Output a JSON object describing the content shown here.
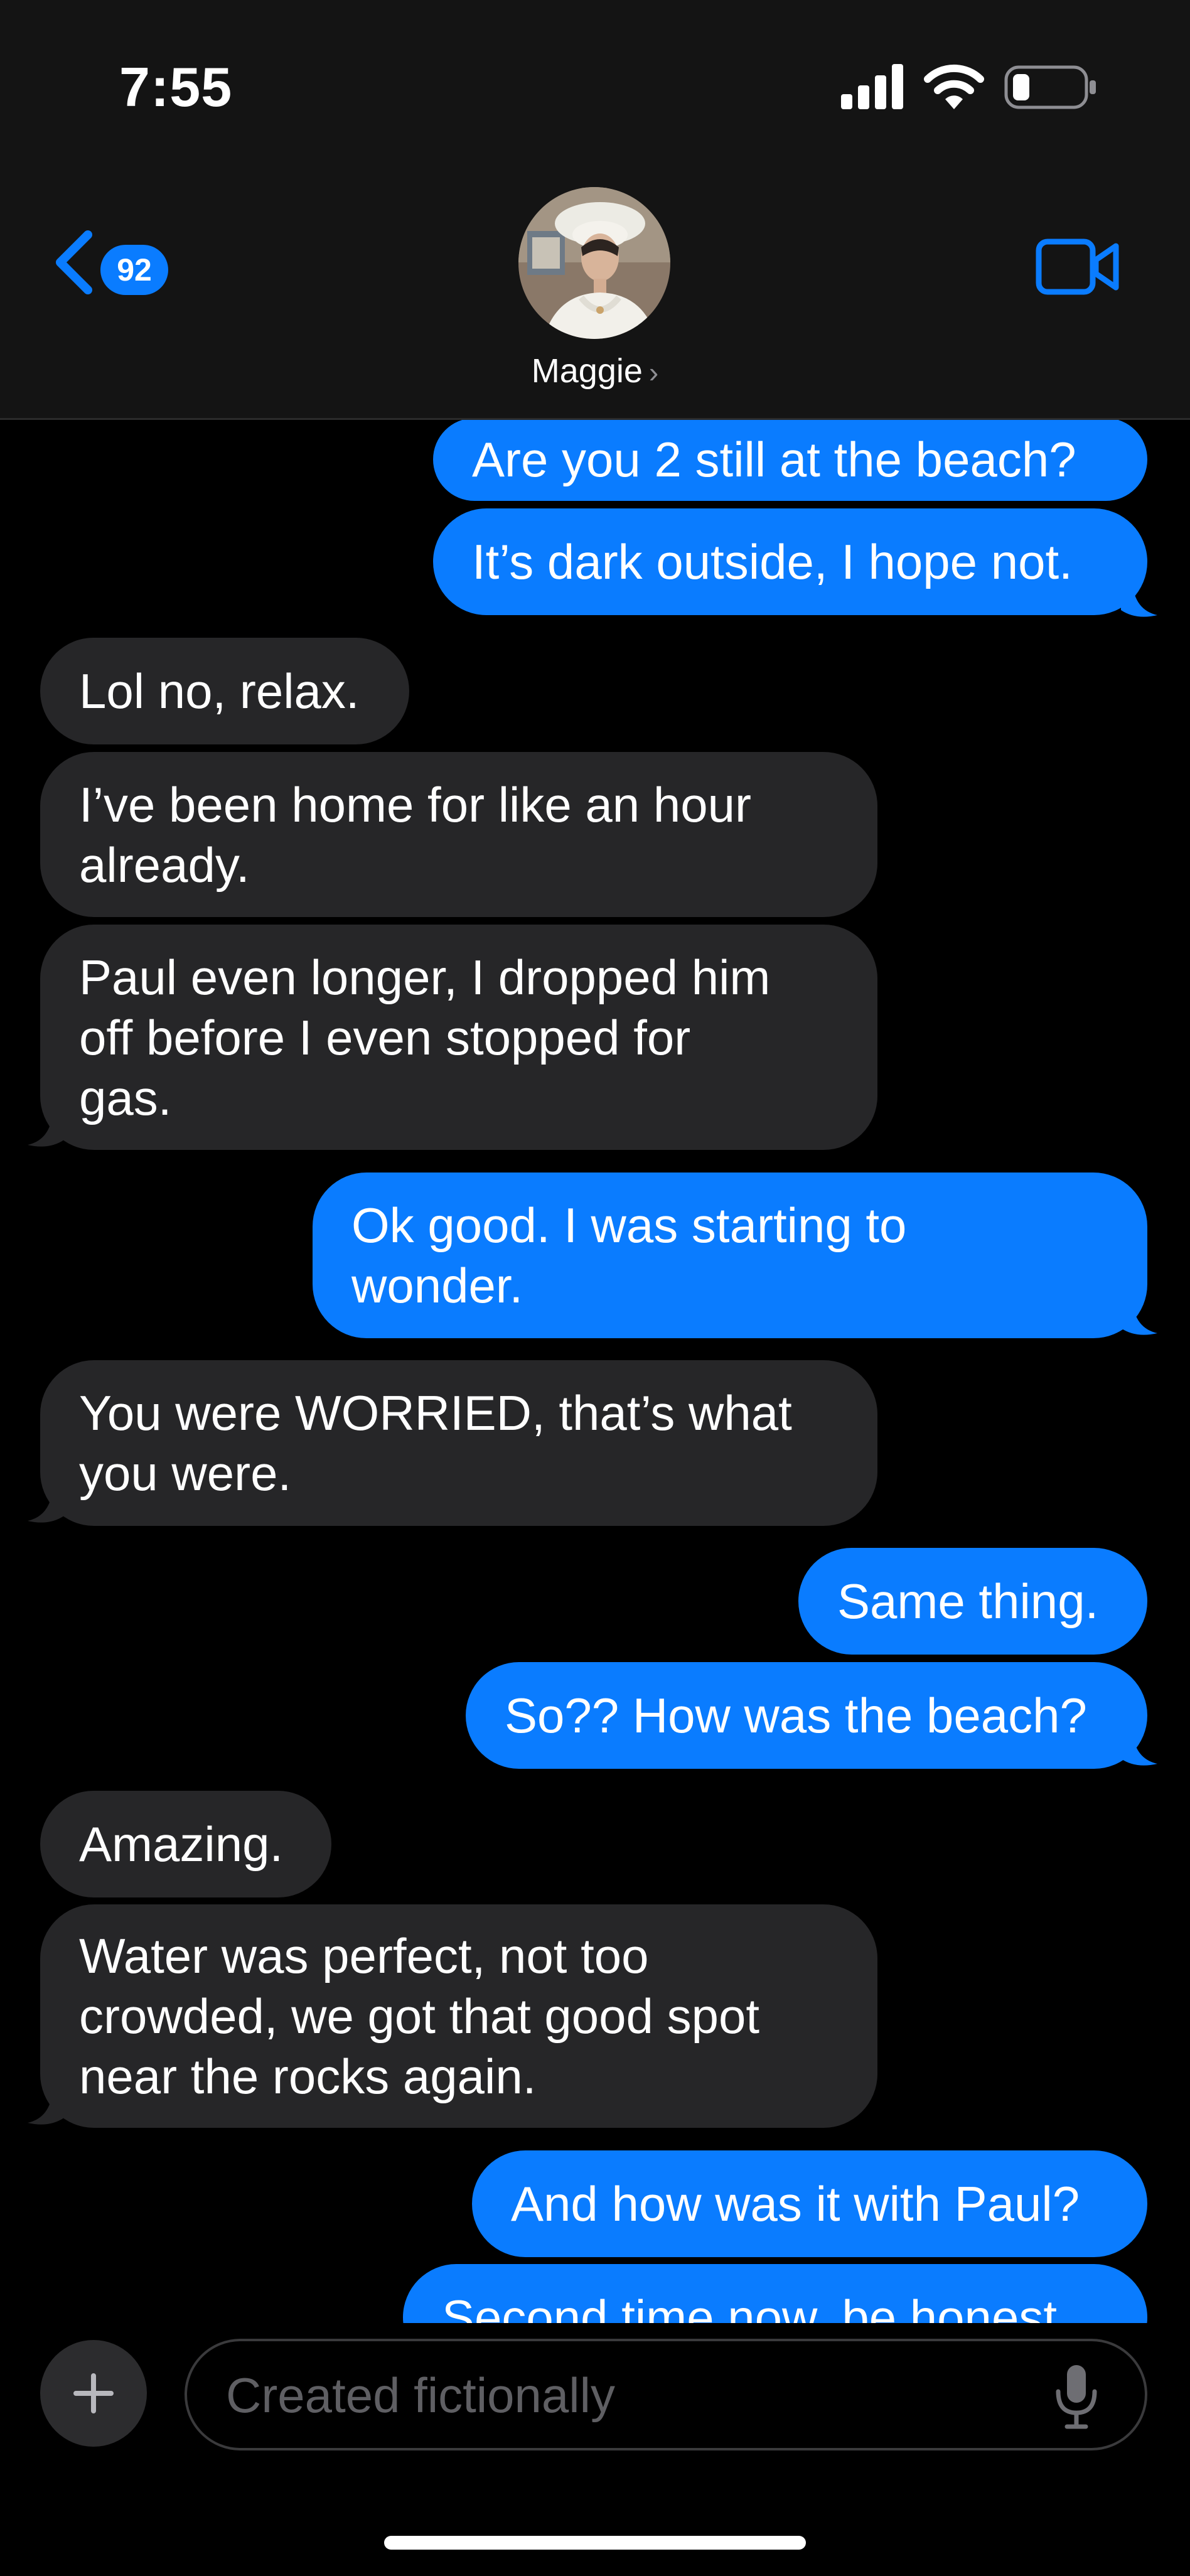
{
  "status_bar": {
    "time": "7:55",
    "icons": [
      "signal-icon",
      "wifi-icon",
      "battery-icon"
    ]
  },
  "header": {
    "back_badge": "92",
    "contact_name": "Maggie",
    "name_chevron": "›",
    "icons": [
      "chevron-left-icon",
      "video-camera-icon"
    ]
  },
  "colors": {
    "accent": "#0a7cff",
    "received_bubble": "#262628",
    "background": "#000000",
    "header_background": "#141414"
  },
  "messages": [
    {
      "direction": "sent",
      "text": "Are you 2 still at the beach?"
    },
    {
      "direction": "sent",
      "text": "It’s dark outside, I hope not."
    },
    {
      "direction": "received",
      "text": "Lol no, relax."
    },
    {
      "direction": "received",
      "text": "I’ve been home for like an hour\nalready."
    },
    {
      "direction": "received",
      "text": "Paul even longer, I dropped him\noff before I even stopped for\ngas."
    },
    {
      "direction": "sent",
      "text": "Ok good. I was starting to\nwonder."
    },
    {
      "direction": "received",
      "text": "You were WORRIED, that’s what\nyou were."
    },
    {
      "direction": "sent",
      "text": "Same thing."
    },
    {
      "direction": "sent",
      "text": "So?? How was the beach?"
    },
    {
      "direction": "received",
      "text": "Amazing."
    },
    {
      "direction": "received",
      "text": "Water was perfect, not too\ncrowded, we got that good spot\nnear the rocks again."
    },
    {
      "direction": "sent",
      "text": "And how was it with Paul?"
    },
    {
      "direction": "sent",
      "text": "Second time now, be honest."
    }
  ],
  "composer": {
    "placeholder": "Created fictionally",
    "icons": [
      "plus-icon",
      "microphone-icon"
    ]
  }
}
